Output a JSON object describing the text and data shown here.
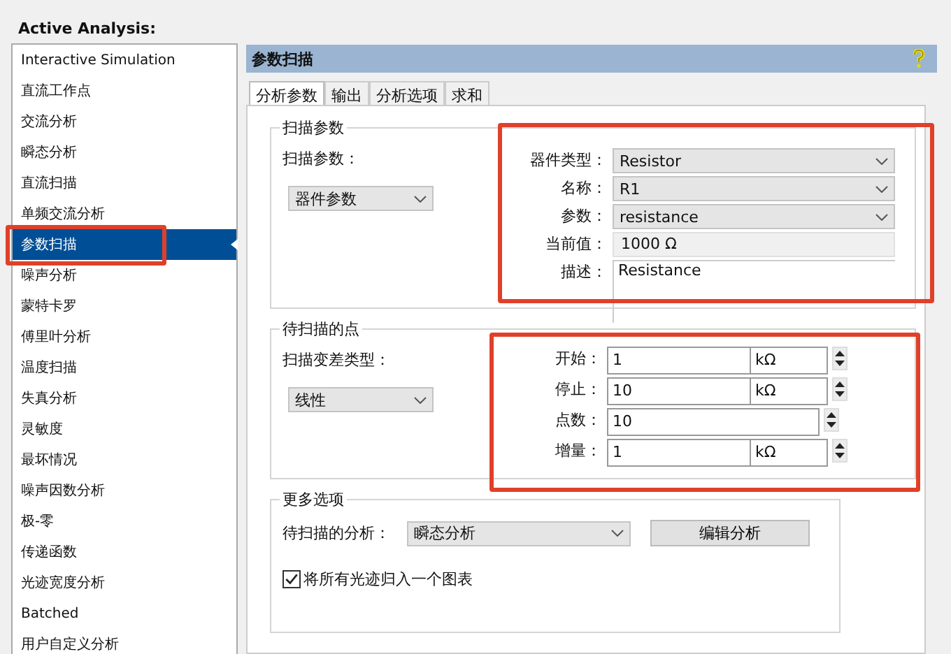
{
  "panel_title": "Active Analysis:",
  "analyses": [
    {
      "label": "Interactive Simulation",
      "selected": false,
      "highlighted": false
    },
    {
      "label": "直流工作点",
      "selected": false,
      "highlighted": false
    },
    {
      "label": "交流分析",
      "selected": false,
      "highlighted": false
    },
    {
      "label": "瞬态分析",
      "selected": false,
      "highlighted": false
    },
    {
      "label": "直流扫描",
      "selected": false,
      "highlighted": false
    },
    {
      "label": "单频交流分析",
      "selected": false,
      "highlighted": false
    },
    {
      "label": "参数扫描",
      "selected": true,
      "highlighted": true
    },
    {
      "label": "噪声分析",
      "selected": false,
      "highlighted": false
    },
    {
      "label": "蒙特卡罗",
      "selected": false,
      "highlighted": false
    },
    {
      "label": "傅里叶分析",
      "selected": false,
      "highlighted": false
    },
    {
      "label": "温度扫描",
      "selected": false,
      "highlighted": false
    },
    {
      "label": "失真分析",
      "selected": false,
      "highlighted": false
    },
    {
      "label": "灵敏度",
      "selected": false,
      "highlighted": false
    },
    {
      "label": "最坏情况",
      "selected": false,
      "highlighted": false
    },
    {
      "label": "噪声因数分析",
      "selected": false,
      "highlighted": false
    },
    {
      "label": "极-零",
      "selected": false,
      "highlighted": false
    },
    {
      "label": "传递函数",
      "selected": false,
      "highlighted": false
    },
    {
      "label": "光迹宽度分析",
      "selected": false,
      "highlighted": false
    },
    {
      "label": "Batched",
      "selected": false,
      "highlighted": false
    },
    {
      "label": "用户自定义分析",
      "selected": false,
      "highlighted": false
    }
  ],
  "section": {
    "title": "参数扫描",
    "tabs": [
      {
        "label": "分析参数",
        "selected": true
      },
      {
        "label": "输出",
        "selected": false
      },
      {
        "label": "分析选项",
        "selected": false
      },
      {
        "label": "求和",
        "selected": false
      }
    ],
    "sweep_parameters": {
      "title": "扫描参数",
      "label": "扫描参数：",
      "type": "器件参数",
      "highlighted": true,
      "fields": [
        {
          "kind": "dropdown",
          "label": "器件类型：",
          "value": "Resistor"
        },
        {
          "kind": "dropdown",
          "label": "名称：",
          "value": "R1"
        },
        {
          "kind": "dropdown",
          "label": "参数：",
          "value": "resistance"
        },
        {
          "kind": "readonly",
          "label": "当前值：",
          "value": "1000 Ω"
        },
        {
          "kind": "multiline",
          "label": "描述：",
          "value": "Resistance"
        }
      ]
    },
    "points": {
      "title": "待扫描的点",
      "label": "扫描变差类型：",
      "type": "线性",
      "highlighted": true,
      "fields": [
        {
          "label": "开始：",
          "value": "1",
          "unit": "kΩ"
        },
        {
          "label": "停止：",
          "value": "10",
          "unit": "kΩ"
        },
        {
          "label": "点数：",
          "value": "10"
        },
        {
          "label": "增量：",
          "value": "1",
          "unit": "kΩ"
        }
      ]
    },
    "more_options": {
      "title": "更多选项",
      "analysis_label": "待扫描的分析：",
      "analysis": "瞬态分析",
      "button": "编辑分析",
      "checkbox": {
        "label": "将所有光迹归入一个图表",
        "checked": true
      }
    }
  }
}
